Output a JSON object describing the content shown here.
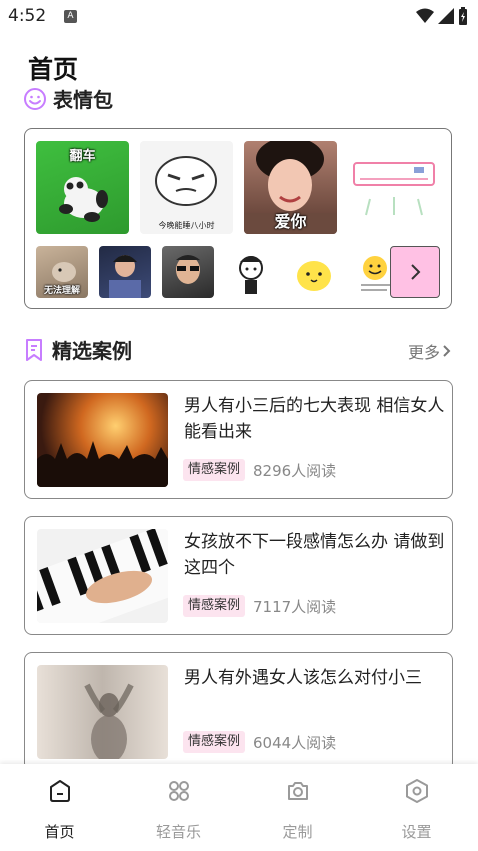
{
  "status_bar": {
    "time": "4:52",
    "notif_letter": "A"
  },
  "page": {
    "title": "首页"
  },
  "stickers_section": {
    "title": "表情包",
    "top_row": [
      {
        "caption": "翻车"
      },
      {
        "caption": "今晚能睡八小时"
      },
      {
        "caption": "爱你"
      },
      {
        "caption": ""
      }
    ],
    "bottom_row": [
      {
        "caption": "无法理解"
      },
      {
        "caption": ""
      },
      {
        "caption": ""
      },
      {
        "caption": ""
      },
      {
        "caption": ""
      },
      {
        "caption": ""
      }
    ],
    "next_icon": "chevron-right-icon"
  },
  "cases_section": {
    "title": "精选案例",
    "more_label": "更多",
    "items": [
      {
        "title": "男人有小三后的七大表现  相信女人能看出来",
        "tag": "情感案例",
        "reads": "8296人阅读"
      },
      {
        "title": "女孩放不下一段感情怎么办  请做到这四个",
        "tag": "情感案例",
        "reads": "7117人阅读"
      },
      {
        "title": "男人有外遇女人该怎么对付小三",
        "tag": "情感案例",
        "reads": "6044人阅读"
      }
    ]
  },
  "tabbar": {
    "tabs": [
      {
        "label": "首页",
        "icon": "home-icon",
        "active": true
      },
      {
        "label": "轻音乐",
        "icon": "music-grid-icon",
        "active": false
      },
      {
        "label": "定制",
        "icon": "camera-icon",
        "active": false
      },
      {
        "label": "设置",
        "icon": "settings-hexagon-icon",
        "active": false
      }
    ]
  },
  "colors": {
    "accent": "#c77dff",
    "tag_bg": "#fce4ef",
    "next_btn": "#ffc1e4"
  }
}
